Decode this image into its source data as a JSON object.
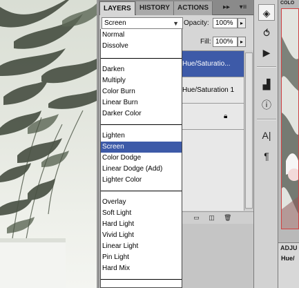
{
  "panel": {
    "tabs": [
      {
        "label": "LAYERS",
        "active": true
      },
      {
        "label": "HISTORY",
        "active": false
      },
      {
        "label": "ACTIONS",
        "active": false
      }
    ],
    "tab_more": "▸▸",
    "tab_menu": "▾≡",
    "blend_mode": "Screen",
    "opacity_label": "Opacity:",
    "opacity_value": "100%",
    "fill_label": "Fill:",
    "fill_value": "100%",
    "layers": [
      {
        "name": "Hue/Saturatio...",
        "selected": true
      },
      {
        "name": "Hue/Saturation 1",
        "selected": false
      }
    ]
  },
  "blend_menu": {
    "groups": [
      [
        "Normal",
        "Dissolve"
      ],
      [
        "Darken",
        "Multiply",
        "Color Burn",
        "Linear Burn",
        "Darker Color"
      ],
      [
        "Lighten",
        "Screen",
        "Color Dodge",
        "Linear Dodge (Add)",
        "Lighter Color"
      ],
      [
        "Overlay",
        "Soft Light",
        "Hard Light",
        "Vivid Light",
        "Linear Light",
        "Pin Light",
        "Hard Mix"
      ]
    ],
    "selected": "Screen"
  },
  "right_panel": {
    "tab_label": "COLO",
    "adjustments_tab": "ADJU",
    "adjustment_title": "Hue/"
  },
  "colors": {
    "selection": "#3d5aa8",
    "panel_bg": "#d6d6d6",
    "tab_bar": "#8a8a8a"
  }
}
